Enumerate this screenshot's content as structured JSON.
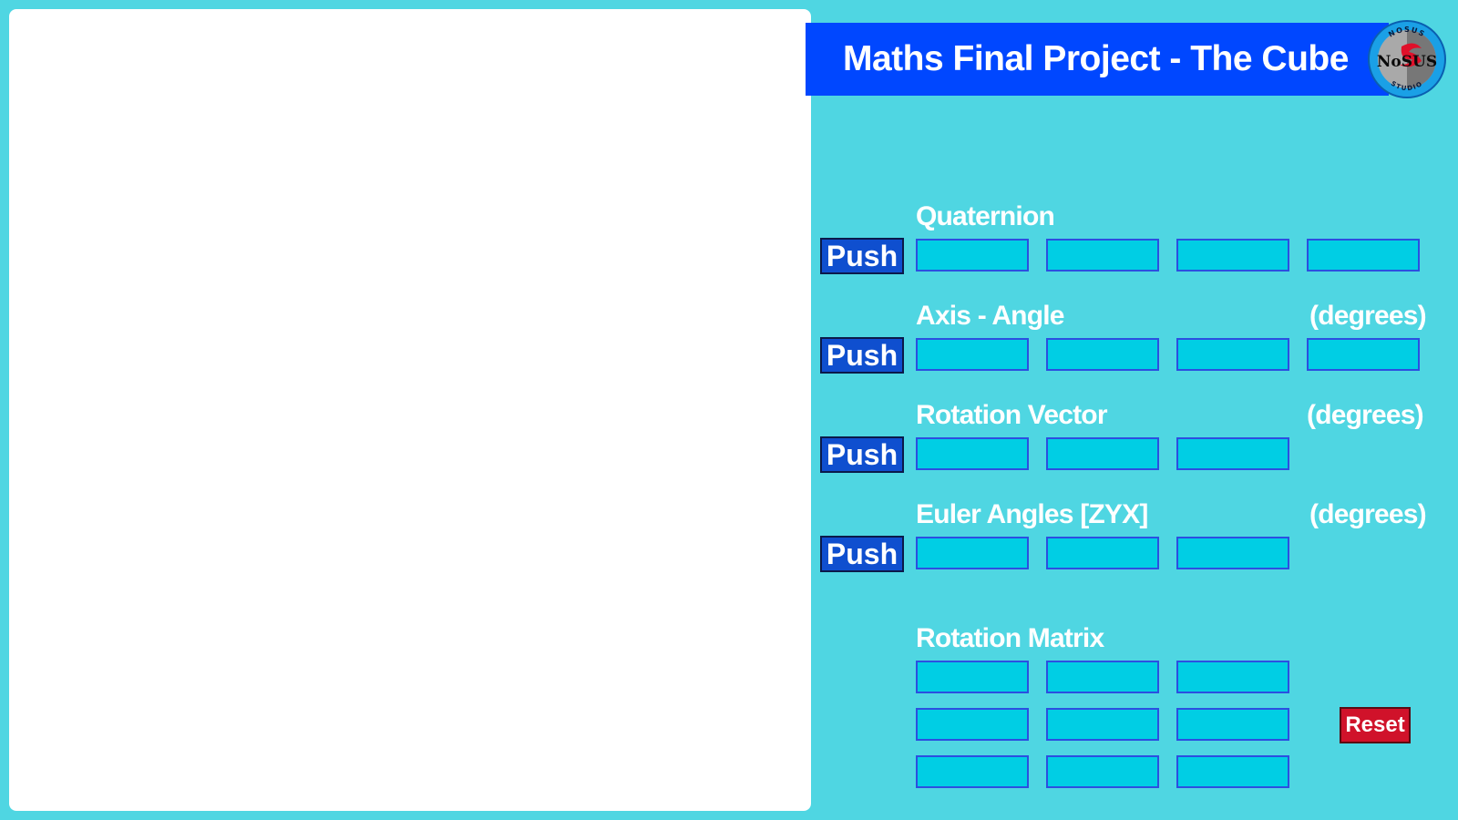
{
  "header": {
    "title": "Maths Final Project - The Cube",
    "logo": {
      "icon": "nosus-studio-logo-icon",
      "top_text": "NOSUS",
      "bottom_text": "STUDIO",
      "mark": "NoSUS"
    }
  },
  "colors": {
    "background": "#4fd6e2",
    "title_bar": "#0047ff",
    "push_button": "#0f4fcf",
    "field": "#00cee4",
    "reset_button": "#d0122a"
  },
  "sections": {
    "quaternion": {
      "label": "Quaternion",
      "unit": "",
      "push_label": "Push",
      "fields": [
        "",
        "",
        "",
        ""
      ]
    },
    "axis_angle": {
      "label": "Axis - Angle",
      "unit": "(degrees)",
      "push_label": "Push",
      "fields": [
        "",
        "",
        "",
        ""
      ]
    },
    "rotation_vector": {
      "label": "Rotation Vector",
      "unit": "(degrees)",
      "push_label": "Push",
      "fields": [
        "",
        "",
        ""
      ]
    },
    "euler_angles": {
      "label": "Euler Angles [ZYX]",
      "unit": "(degrees)",
      "push_label": "Push",
      "fields": [
        "",
        "",
        ""
      ]
    },
    "rotation_matrix": {
      "label": "Rotation Matrix",
      "rows": [
        [
          "",
          "",
          ""
        ],
        [
          "",
          "",
          ""
        ],
        [
          "",
          "",
          ""
        ]
      ]
    }
  },
  "reset_label": "Reset"
}
